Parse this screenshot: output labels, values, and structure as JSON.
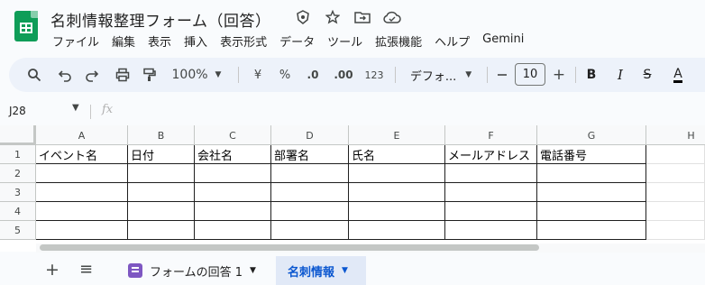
{
  "app": {
    "doc_title": "名刺情報整理フォーム（回答）",
    "title_icons": [
      "hide-icon",
      "star-icon",
      "move-folder-icon",
      "cloud-saved-icon"
    ]
  },
  "menu": [
    "ファイル",
    "編集",
    "表示",
    "挿入",
    "表示形式",
    "データ",
    "ツール",
    "拡張機能",
    "ヘルプ",
    "Gemini"
  ],
  "toolbar": {
    "zoom": "100%",
    "currency": "¥",
    "percent": "%",
    "decimal_decrease": ".0",
    "decimal_increase": ".00",
    "number_format": "123",
    "font_name": "デフォ...",
    "font_size": "10",
    "minus": "—",
    "plus": "+",
    "bold": "B",
    "italic": "I",
    "strike": "S",
    "text_color": "A"
  },
  "formula_bar": {
    "name_box": "J28",
    "fx": "fx"
  },
  "columns": [
    "A",
    "B",
    "C",
    "D",
    "E",
    "F",
    "G",
    "H"
  ],
  "rows": [
    "1",
    "2",
    "3",
    "4",
    "5"
  ],
  "header_cells": [
    "イベント名",
    "日付",
    "会社名",
    "部署名",
    "氏名",
    "メールアドレス",
    "電話番号"
  ],
  "sheets": {
    "add": "+",
    "menu": "≡",
    "tabs": [
      {
        "label": "フォームの回答 1",
        "active": false
      },
      {
        "label": "名刺情報",
        "active": true
      }
    ]
  },
  "colors": {
    "accent": "#0b57d0",
    "sheets_green": "#0f9d58",
    "forms_purple": "#7e57c2"
  }
}
